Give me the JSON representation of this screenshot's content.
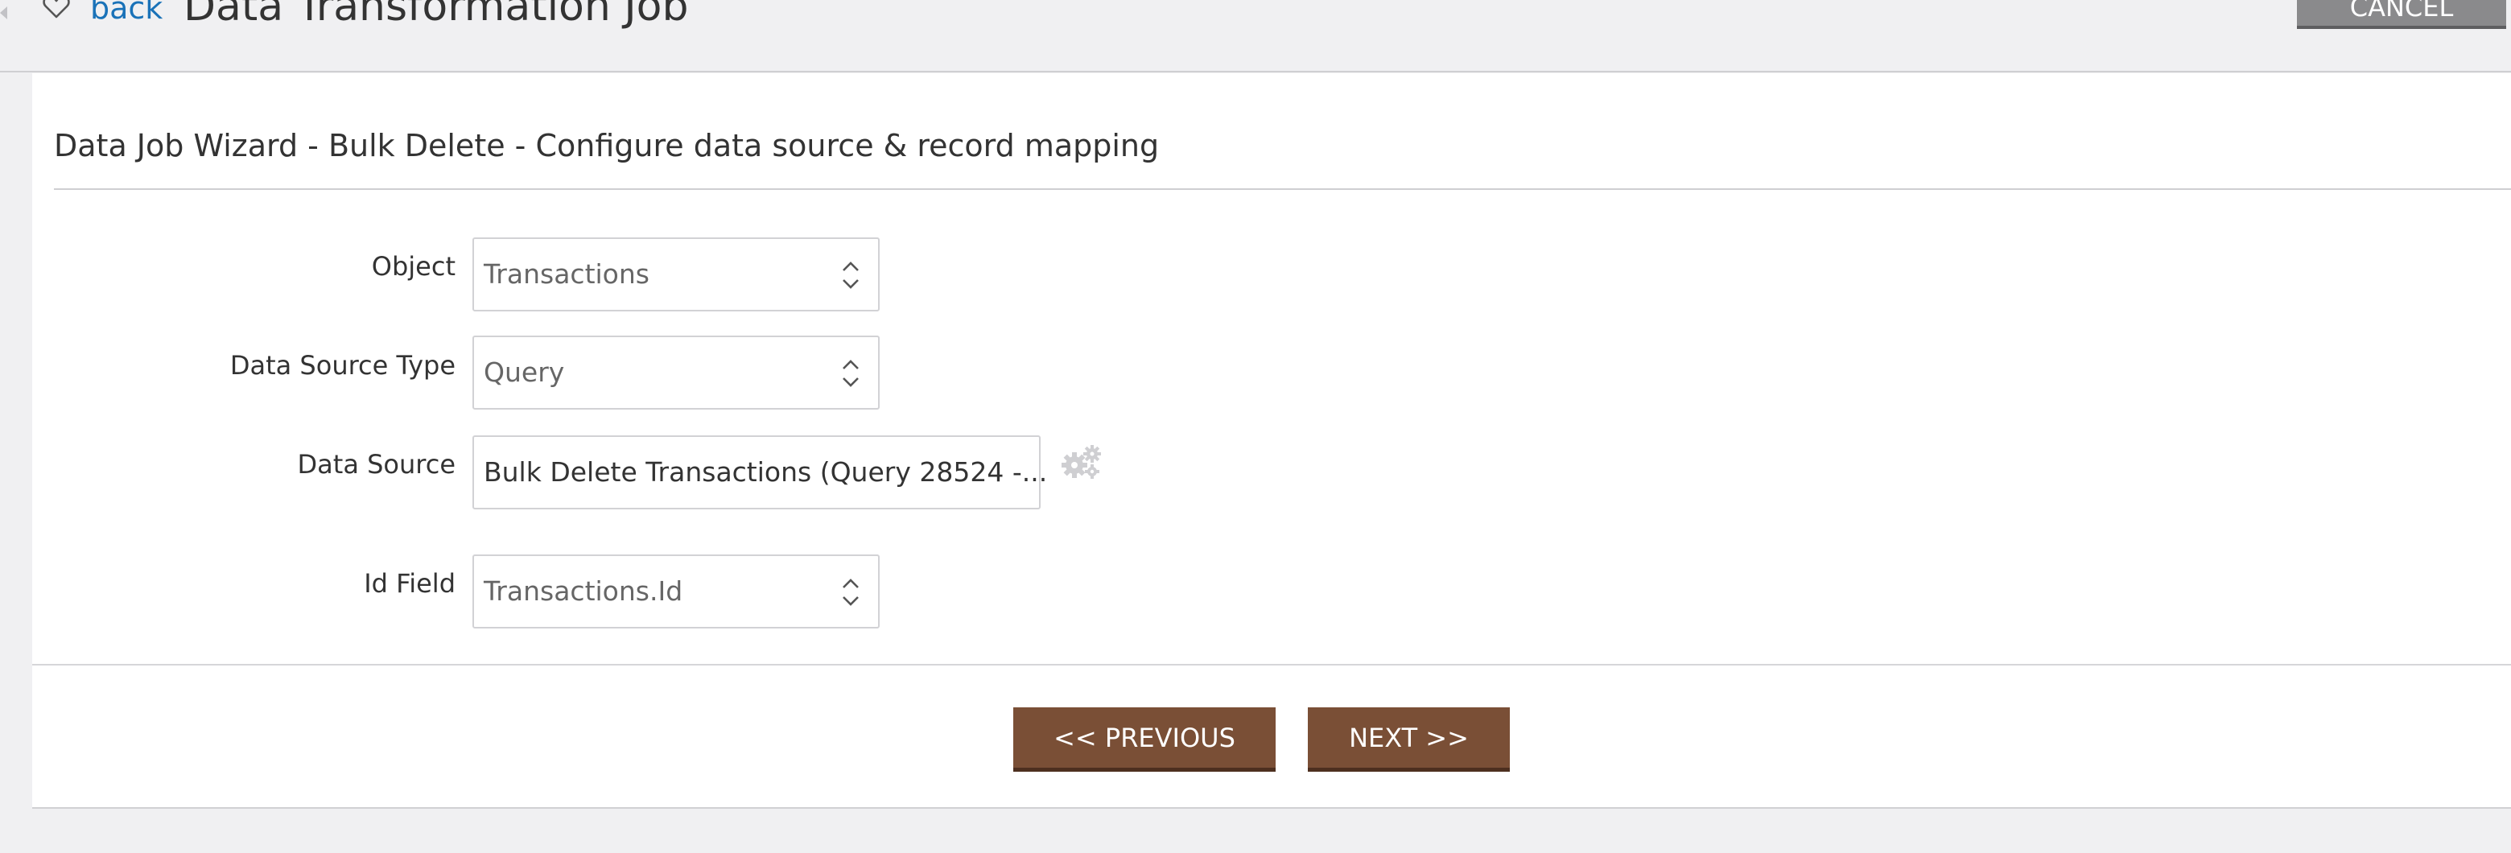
{
  "header": {
    "back_label": "back",
    "title": "Data Transformation Job",
    "cancel_label": "CANCEL"
  },
  "wizard": {
    "heading": "Data Job Wizard - Bulk Delete - Configure data source & record mapping",
    "fields": {
      "object": {
        "label": "Object",
        "value": "Transactions"
      },
      "data_source_type": {
        "label": "Data Source Type",
        "value": "Query"
      },
      "data_source": {
        "label": "Data Source",
        "value": "Bulk Delete Transactions (Query 28524 -..."
      },
      "id_field": {
        "label": "Id Field",
        "value": "Transactions.Id"
      }
    },
    "previous_label": "<< PREVIOUS",
    "next_label": "NEXT >>"
  },
  "icons": {
    "favorite": "heart-icon",
    "select_arrows": "chevron-up-down-icon",
    "configure": "gears-icon"
  },
  "colors": {
    "link": "#1a72b8",
    "primary_button": "#7a4f36",
    "cancel_button": "#8a8a8c",
    "page_background": "#f0f0f2"
  }
}
